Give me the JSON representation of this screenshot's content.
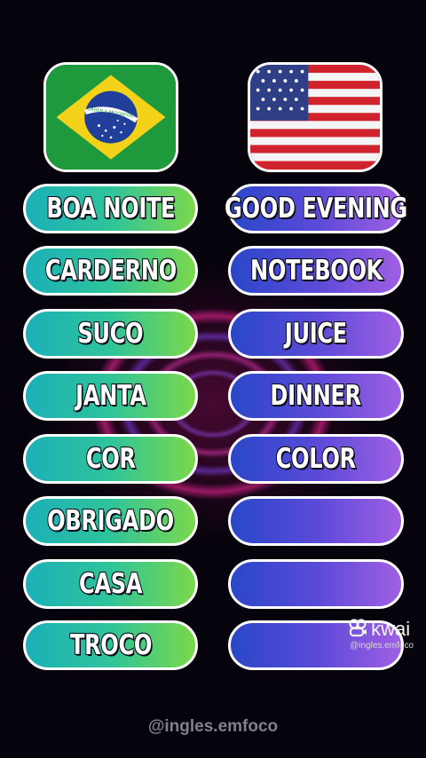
{
  "flags": {
    "left": {
      "icon": "brazil-flag-icon",
      "motto": "ORDEM E PROGRESSO"
    },
    "right": {
      "icon": "usa-flag-icon"
    }
  },
  "rows": [
    {
      "pt": "BOA NOITE",
      "en": "GOOD EVENING"
    },
    {
      "pt": "CARDERNO",
      "en": "NOTEBOOK"
    },
    {
      "pt": "SUCO",
      "en": "JUICE"
    },
    {
      "pt": "JANTA",
      "en": "DINNER"
    },
    {
      "pt": "COR",
      "en": "COLOR"
    },
    {
      "pt": "OBRIGADO",
      "en": ""
    },
    {
      "pt": "CASA",
      "en": ""
    },
    {
      "pt": "TROCO",
      "en": ""
    }
  ],
  "watermark": {
    "icon": "kwai-logo-icon",
    "brand": "kwai",
    "handle": "@ingles.emfoco"
  },
  "footer": {
    "handle": "@ingles.emfoco"
  },
  "colors": {
    "left_pill_gradient": [
      "#1bb0b8",
      "#2fc49a",
      "#7bd84a"
    ],
    "right_pill_gradient": [
      "#2a47c8",
      "#5a4ad8",
      "#a05fe4"
    ],
    "neon_pink": "#ff28a0",
    "neon_purple": "#8c46ff"
  }
}
